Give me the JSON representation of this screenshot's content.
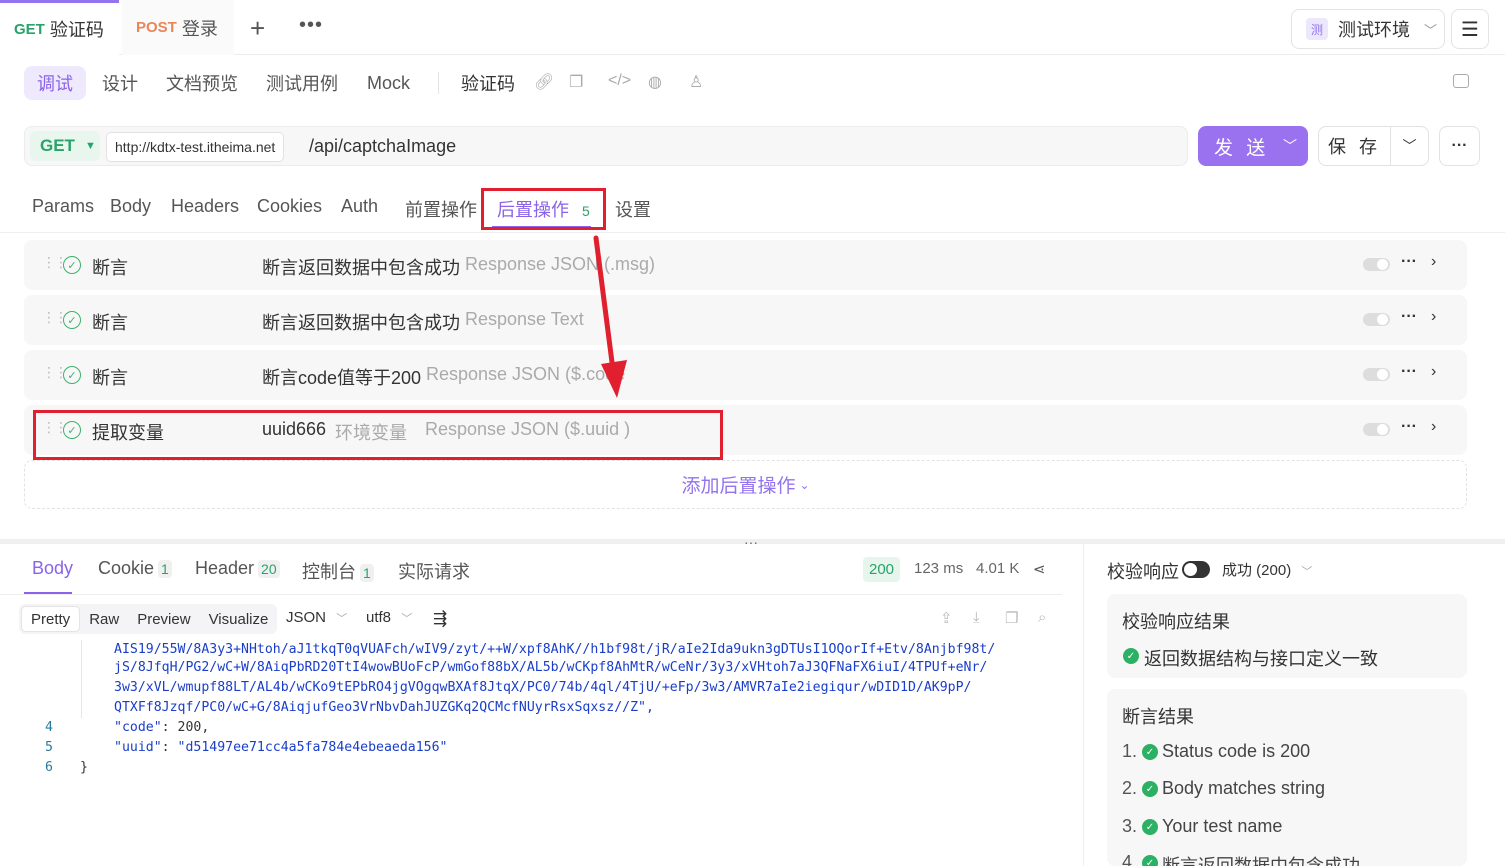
{
  "request_tabs": [
    {
      "method": "GET",
      "name": "验证码"
    },
    {
      "method": "POST",
      "name": "登录"
    }
  ],
  "environment": {
    "badge": "测",
    "name": "测试环境"
  },
  "subtabs": [
    "调试",
    "设计",
    "文档预览",
    "测试用例",
    "Mock"
  ],
  "endpoint_name": "验证码",
  "url": {
    "method": "GET",
    "host": "http://kdtx-test.itheima.net",
    "path": "/api/captchaImage"
  },
  "buttons": {
    "send": "发 送",
    "save": "保 存"
  },
  "req_tabs": [
    "Params",
    "Body",
    "Headers",
    "Cookies",
    "Auth",
    "前置操作",
    "后置操作",
    "设置"
  ],
  "post_ops_count": "5",
  "post_ops": [
    {
      "type": "断言",
      "name": "断言返回数据中包含成功",
      "extra": "",
      "source": "Response JSON (.msg)"
    },
    {
      "type": "断言",
      "name": "断言返回数据中包含成功",
      "extra": "",
      "source": "Response Text"
    },
    {
      "type": "断言",
      "name": "断言code值等于200",
      "extra": "",
      "source": "Response JSON ($.code"
    },
    {
      "type": "提取变量",
      "name": "uuid666",
      "extra": "环境变量",
      "source": "Response JSON ($.uuid )"
    }
  ],
  "add_post_op": "添加后置操作",
  "response": {
    "tabs": [
      {
        "label": "Body",
        "count": ""
      },
      {
        "label": "Cookie",
        "count": "1"
      },
      {
        "label": "Header",
        "count": "20"
      },
      {
        "label": "控制台",
        "count": "1"
      },
      {
        "label": "实际请求",
        "count": ""
      }
    ],
    "status": "200",
    "time": "123 ms",
    "size": "4.01 K",
    "formats": [
      "Pretty",
      "Raw",
      "Preview",
      "Visualize"
    ],
    "lang": "JSON",
    "encoding": "utf8",
    "code_lines": [
      {
        "no": "",
        "text": "AIS19/55W/8A3y3+NHtoh/aJ1tkqT0qVUAFch/wIV9/zyt/++W/xpf8AhK//h1bf98t/jR/aIe2Ida9ukn3gDTUsI1OQorIf+Etv/8Anjbf98t/"
      },
      {
        "no": "",
        "text": "jS/8JfqH/PG2/wC+W/8AiqPbRD20TtI4wowBUoFcP/wmGof88bX/AL5b/wCKpf8AhMtR/wCeNr/3y3/xVHtoh7aJ3QFNaFX6iuI/4TPUf+eNr/"
      },
      {
        "no": "",
        "text": "3w3/xVL/wmupf88LT/AL4b/wCKo9tEPbRO4jgVOgqwBXAf8JtqX/PC0/74b/4ql/4TjU/+eFp/3w3/AMVR7aIe2iegiqur/wDID1D/AK9pP/"
      },
      {
        "no": "",
        "text": "QTXFf8Jzqf/PC0/wC+G/8AiqjufGeo3VrNbvDahJUZGKq2QCMcfNUyrRsxSqxsz//Z\","
      },
      {
        "no": "4",
        "key": "\"code\"",
        "value": "200,"
      },
      {
        "no": "5",
        "key": "\"uuid\"",
        "value": "\"d51497ee71cc4a5fa784e4ebeaeda156\""
      },
      {
        "no": "6",
        "text": "}"
      }
    ]
  },
  "validation": {
    "label": "校验响应",
    "status": "成功 (200)",
    "result_title": "校验响应结果",
    "result_text": "返回数据结构与接口定义一致",
    "assert_title": "断言结果",
    "asserts": [
      {
        "idx": "1.",
        "text": "Status code is 200"
      },
      {
        "idx": "2.",
        "text": "Body matches string"
      },
      {
        "idx": "3.",
        "text": "Your test name"
      },
      {
        "idx": "4.",
        "text": "断言返回数据中包含成功"
      }
    ]
  },
  "colors": {
    "accent": "#8a63e8",
    "success": "#2cb164",
    "highlight": "#e0202e"
  }
}
